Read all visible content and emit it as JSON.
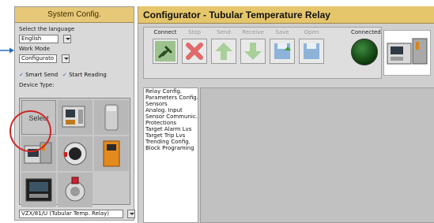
{
  "left_panel": {
    "title": "System Config.",
    "language_label": "Select the language",
    "language_value": "English",
    "workmode_label": "Work Mode",
    "workmode_value": "Configurato",
    "smart_send_label": "Smart Send",
    "start_reading_label": "Start Reading",
    "device_type_label": "Device Type:",
    "select_label": "Select",
    "selected_device": "VZX/81/U (Tubular Temp. Relay)"
  },
  "right_panel": {
    "title": "Configurator -  Tubular Temperature Relay",
    "toolbar": {
      "connect": "Connect",
      "stop": "Stop",
      "send": "Send",
      "receive": "Receive",
      "save": "Save",
      "open": "Open",
      "connected": "Connected"
    },
    "menu_items": [
      "Relay Config.",
      "Parameters Config.",
      "Sensors",
      "Analog. Input",
      "Sensor Communic.",
      "Protections",
      "Target Alarm Lvs",
      "Target Trip Lvs",
      "Trending Config.",
      "Block Programing"
    ]
  },
  "colors": {
    "title_bar": "#e6c66b",
    "connected_led": "#0c3a0c",
    "highlight_circle": "#d02626",
    "pointer_arrow": "#2a6fb8"
  }
}
